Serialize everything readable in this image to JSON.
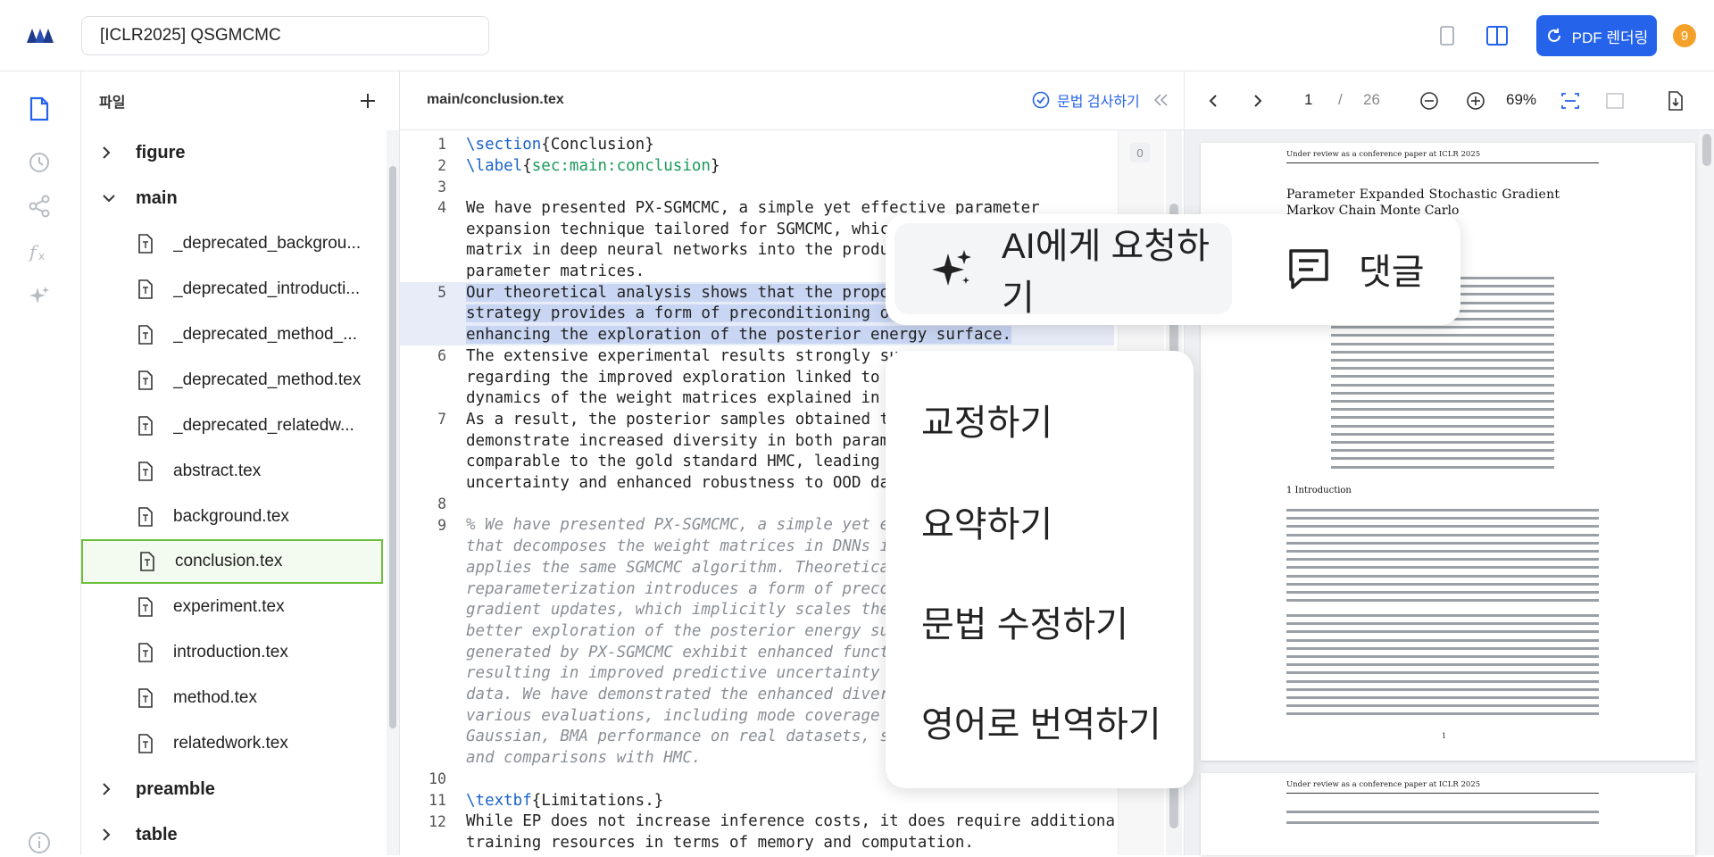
{
  "header": {
    "doc_title": "[ICLR2025] QSGMCMC",
    "render_button": "PDF 렌더링",
    "avatar_count": "9"
  },
  "files_panel": {
    "title": "파일",
    "tree": [
      {
        "type": "folder",
        "name": "figure",
        "expanded": false
      },
      {
        "type": "folder",
        "name": "main",
        "expanded": true
      },
      {
        "type": "file",
        "name": "_deprecated_backgrou..."
      },
      {
        "type": "file",
        "name": "_deprecated_introducti..."
      },
      {
        "type": "file",
        "name": "_deprecated_method_..."
      },
      {
        "type": "file",
        "name": "_deprecated_method.tex"
      },
      {
        "type": "file",
        "name": "_deprecated_relatedw..."
      },
      {
        "type": "file",
        "name": "abstract.tex"
      },
      {
        "type": "file",
        "name": "background.tex"
      },
      {
        "type": "file",
        "name": "conclusion.tex",
        "selected": true
      },
      {
        "type": "file",
        "name": "experiment.tex"
      },
      {
        "type": "file",
        "name": "introduction.tex"
      },
      {
        "type": "file",
        "name": "method.tex"
      },
      {
        "type": "file",
        "name": "relatedwork.tex"
      },
      {
        "type": "folder",
        "name": "preamble",
        "expanded": false
      },
      {
        "type": "folder",
        "name": "table",
        "expanded": false
      }
    ]
  },
  "editor": {
    "file_path": "main/conclusion.tex",
    "grammar_check": "문법 검사하기",
    "comment_count": "0",
    "lines": [
      {
        "n": "1",
        "text": "\\section{Conclusion}"
      },
      {
        "n": "2",
        "text": "\\label{sec:main:conclusion}"
      },
      {
        "n": "3",
        "text": ""
      },
      {
        "n": "4",
        "text": "We have presented PX-SGMCMC, a simple yet effective parameter"
      },
      {
        "n": "",
        "text": "expansion technique tailored for SGMCMC, which"
      },
      {
        "n": "",
        "text": "matrix in deep neural networks into the produc"
      },
      {
        "n": "",
        "text": "parameter matrices."
      },
      {
        "n": "5",
        "text": "Our theoretical analysis shows that the propos"
      },
      {
        "n": "",
        "text": "strategy provides a form of preconditioning on"
      },
      {
        "n": "",
        "text": "enhancing the exploration of the posterior energy surface."
      },
      {
        "n": "6",
        "text": "The extensive experimental results strongly sur"
      },
      {
        "n": "",
        "text": "regarding the improved exploration linked to t"
      },
      {
        "n": "",
        "text": "dynamics of the weight matrices explained in o"
      },
      {
        "n": "7",
        "text": "As a result, the posterior samples obtained th"
      },
      {
        "n": "",
        "text": "demonstrate increased diversity in both parame"
      },
      {
        "n": "",
        "text": "comparable to the gold standard HMC, leading t"
      },
      {
        "n": "",
        "text": "uncertainty and enhanced robustness to OOD dat"
      },
      {
        "n": "8",
        "text": ""
      },
      {
        "n": "9",
        "text": "% We have presented PX-SGMCMC, a simple yet ef"
      },
      {
        "n": "",
        "text": "that decomposes the weight matrices in DNNs in"
      },
      {
        "n": "",
        "text": "applies the same SGMCMC algorithm. Theoretical"
      },
      {
        "n": "",
        "text": "reparameterization introduces a form of precon"
      },
      {
        "n": "",
        "text": "gradient updates, which implicitly scales the"
      },
      {
        "n": "",
        "text": "better exploration of the posterior energy sur"
      },
      {
        "n": "",
        "text": "generated by PX-SGMCMC exhibit enhanced functi"
      },
      {
        "n": "",
        "text": "resulting in improved predictive uncertainty a"
      },
      {
        "n": "",
        "text": "data. We have demonstrated the enhanced divers"
      },
      {
        "n": "",
        "text": "various evaluations, including mode coverage i"
      },
      {
        "n": "",
        "text": "Gaussian, BMA performance on real datasets, si"
      },
      {
        "n": "",
        "text": "and comparisons with HMC."
      },
      {
        "n": "10",
        "text": ""
      },
      {
        "n": "11",
        "text": "\\textbf{Limitations.}"
      },
      {
        "n": "12",
        "text": "While EP does not increase inference costs, it does require additional"
      },
      {
        "n": "",
        "text": "training resources in terms of memory and computation."
      }
    ]
  },
  "pdf": {
    "page": "1",
    "separator": "/",
    "total": "26",
    "zoom": "69%",
    "page1": {
      "header": "Under review as a conference paper at ICLR 2025",
      "title_line1": "Parameter Expanded Stochastic Gradient",
      "title_line2": "Markov Chain Monte Carlo",
      "section": "1   Introduction",
      "page_number": "1"
    },
    "page2": {
      "header": "Under review as a conference paper at ICLR 2025"
    }
  },
  "ai_popup": {
    "ask_ai": "AI에게 요청하기",
    "comment": "댓글"
  },
  "ai_menu": {
    "items": [
      "교정하기",
      "요약하기",
      "문법 수정하기",
      "영어로 번역하기"
    ]
  },
  "colors": {
    "accent": "#2563eb",
    "selected_border": "#6cbf3e",
    "avatar": "#f4a12a",
    "latex_command": "#1a63c9",
    "latex_arg": "#1a9a5a",
    "comment": "#8a8f96"
  }
}
